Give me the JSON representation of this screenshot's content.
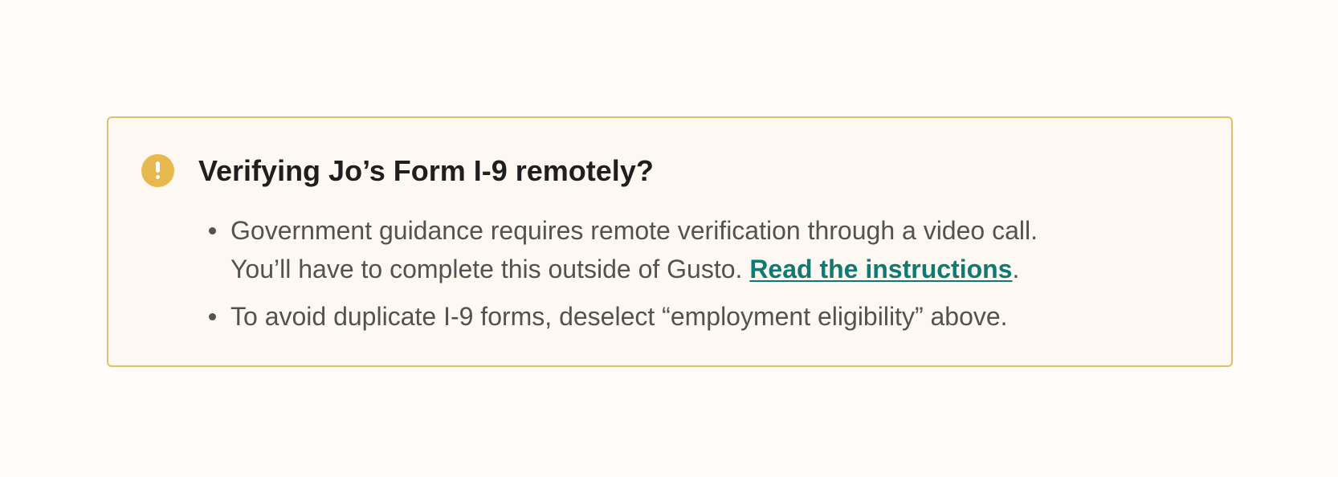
{
  "alert": {
    "icon": "exclamation-circle-icon",
    "title": "Verifying Jo’s Form I-9 remotely?",
    "items": [
      {
        "line1": "Government guidance requires remote verification through a video call.",
        "line2_prefix": "You’ll have to complete this outside of Gusto.",
        "link_text": "Read the instructions",
        "suffix": "."
      },
      {
        "text": "To avoid duplicate I-9 forms, deselect “employment eligibility” above."
      }
    ]
  },
  "colors": {
    "page_background": "#fefdfc",
    "alert_background": "#fdf8f1",
    "alert_border": "#e3c067",
    "icon": "#e7b84c",
    "title_text": "#1f1f1f",
    "body_text": "#525252",
    "link": "#0f7a72"
  }
}
